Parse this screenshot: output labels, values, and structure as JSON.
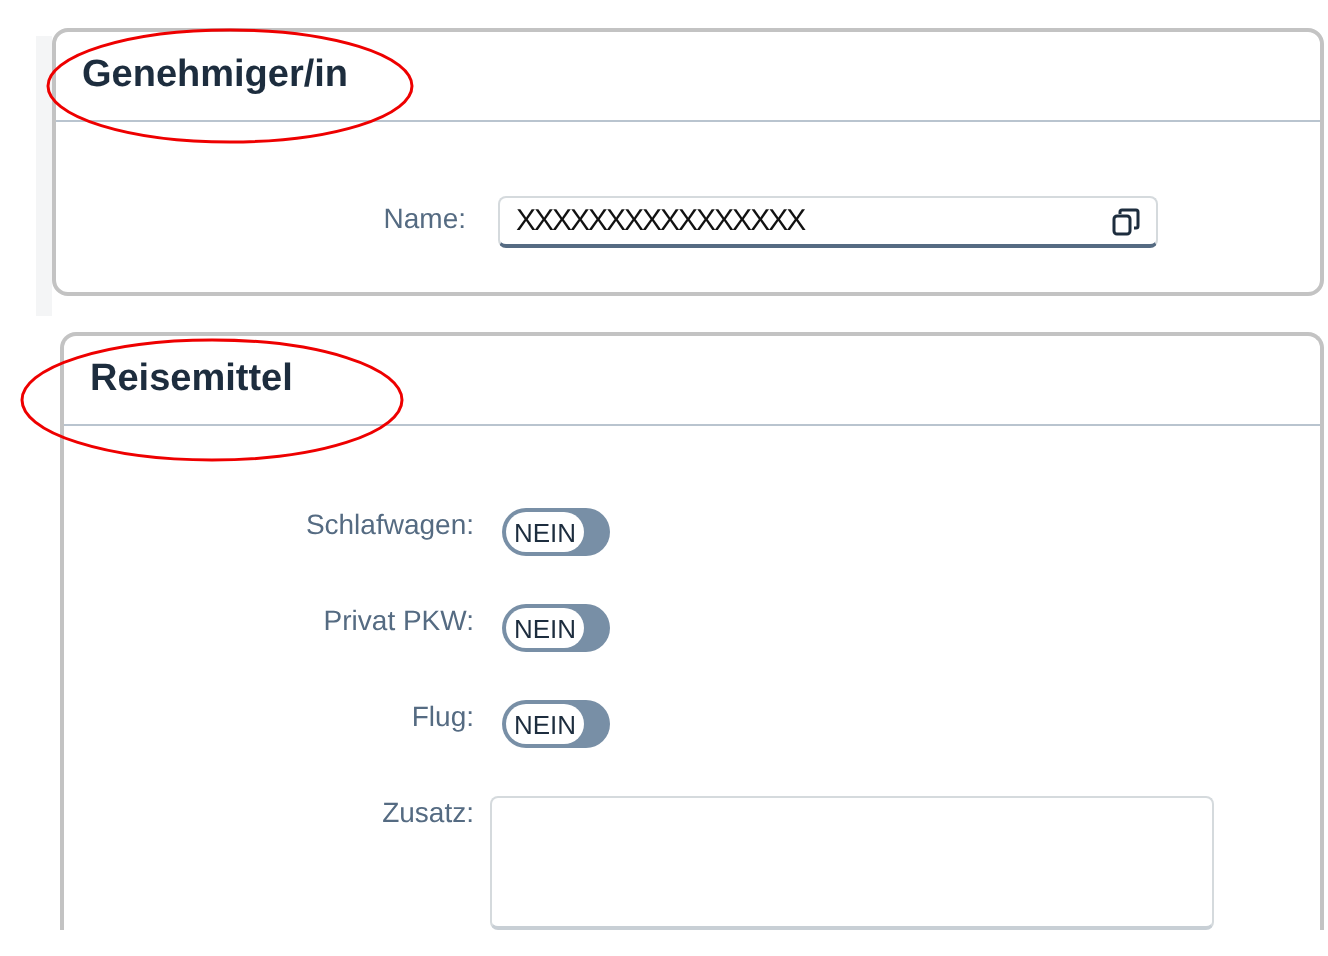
{
  "approver": {
    "title": "Genehmiger/in",
    "name_label": "Name:",
    "name_value": "XXXXXXXXXXXXXXXX"
  },
  "travel": {
    "title": "Reisemittel",
    "options": [
      {
        "label": "Schlafwagen:",
        "state": "NEIN",
        "on": false
      },
      {
        "label": "Privat PKW:",
        "state": "NEIN",
        "on": false
      },
      {
        "label": "Flug:",
        "state": "NEIN",
        "on": false
      }
    ],
    "note_label": "Zusatz:"
  }
}
